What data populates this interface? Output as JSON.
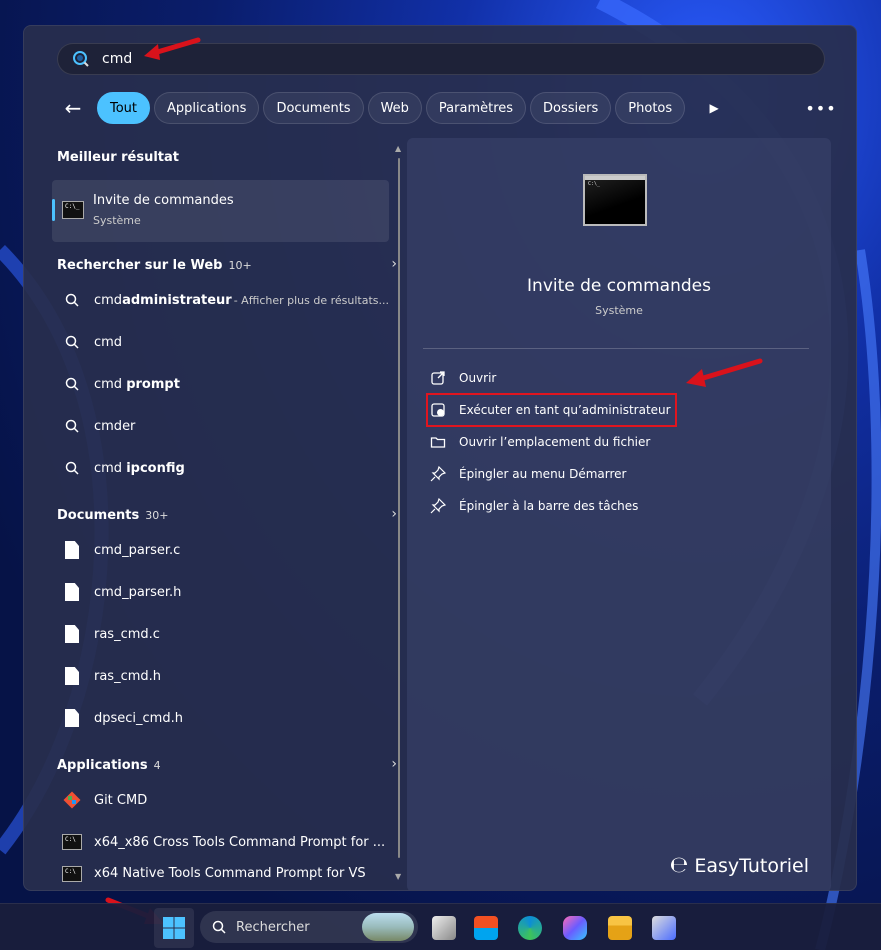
{
  "search": {
    "query": "cmd"
  },
  "tabs": {
    "items": [
      "Tout",
      "Applications",
      "Documents",
      "Web",
      "Paramètres",
      "Dossiers",
      "Photos"
    ],
    "active": "Tout"
  },
  "best_match": {
    "heading": "Meilleur résultat",
    "title": "Invite de commandes",
    "subtitle": "Système"
  },
  "web": {
    "heading": "Rechercher sur le Web",
    "count": "10+",
    "items": [
      {
        "prefix": "cmd ",
        "bold": "administrateur",
        "suffix": " - Afficher plus de résultats..."
      },
      {
        "prefix": "cmd",
        "bold": "",
        "suffix": ""
      },
      {
        "prefix": "cmd ",
        "bold": "prompt",
        "suffix": ""
      },
      {
        "prefix": "cmder",
        "bold": "",
        "suffix": ""
      },
      {
        "prefix": "cmd ",
        "bold": "ipconfig",
        "suffix": ""
      }
    ]
  },
  "documents": {
    "heading": "Documents",
    "count": "30+",
    "items": [
      "cmd_parser.c",
      "cmd_parser.h",
      "ras_cmd.c",
      "ras_cmd.h",
      "dpseci_cmd.h"
    ]
  },
  "applications": {
    "heading": "Applications",
    "count": "4",
    "items": [
      "Git CMD",
      "x64_x86 Cross Tools Command Prompt for ...",
      "x64 Native Tools Command Prompt for VS"
    ]
  },
  "detail": {
    "title": "Invite de commandes",
    "subtitle": "Système",
    "actions": [
      {
        "label": "Ouvrir",
        "icon": "open-external-icon"
      },
      {
        "label": "Exécuter en tant qu’administrateur",
        "icon": "shield-admin-icon"
      },
      {
        "label": "Ouvrir l’emplacement du fichier",
        "icon": "folder-icon"
      },
      {
        "label": "Épingler au menu Démarrer",
        "icon": "pin-icon"
      },
      {
        "label": "Épingler à la barre des tâches",
        "icon": "pin-icon"
      }
    ]
  },
  "watermark": {
    "text": "EasyTutoriel"
  },
  "taskbar": {
    "search_placeholder": "Rechercher"
  },
  "colors": {
    "accent": "#4cc2ff",
    "highlight": "#e0151f"
  }
}
